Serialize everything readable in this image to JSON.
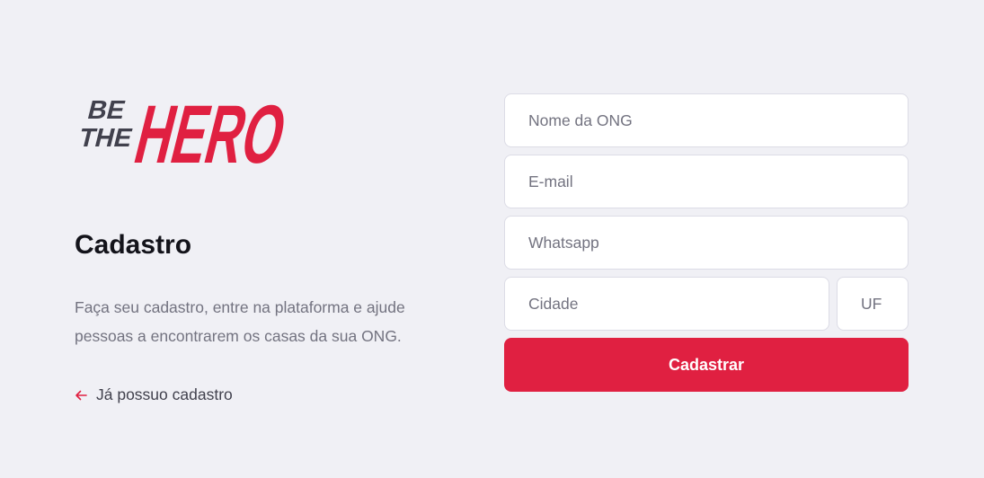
{
  "logo": {
    "alt": "Be The Hero",
    "line1": "BE",
    "line2": "THE",
    "word": "HERO"
  },
  "page": {
    "title": "Cadastro",
    "description": "Faça seu cadastro, entre na plataforma e ajude pessoas a encontrarem os casas da sua ONG.",
    "back_link": "Já possuo cadastro"
  },
  "form": {
    "name_placeholder": "Nome da ONG",
    "email_placeholder": "E-mail",
    "whatsapp_placeholder": "Whatsapp",
    "city_placeholder": "Cidade",
    "uf_placeholder": "UF",
    "submit_label": "Cadastrar"
  },
  "colors": {
    "brand": "#e02041",
    "logo_dark": "#41414d",
    "background": "#f0f0f5",
    "text": "#13131a",
    "muted": "#737380"
  },
  "icons": {
    "back": "arrow-left-icon"
  }
}
